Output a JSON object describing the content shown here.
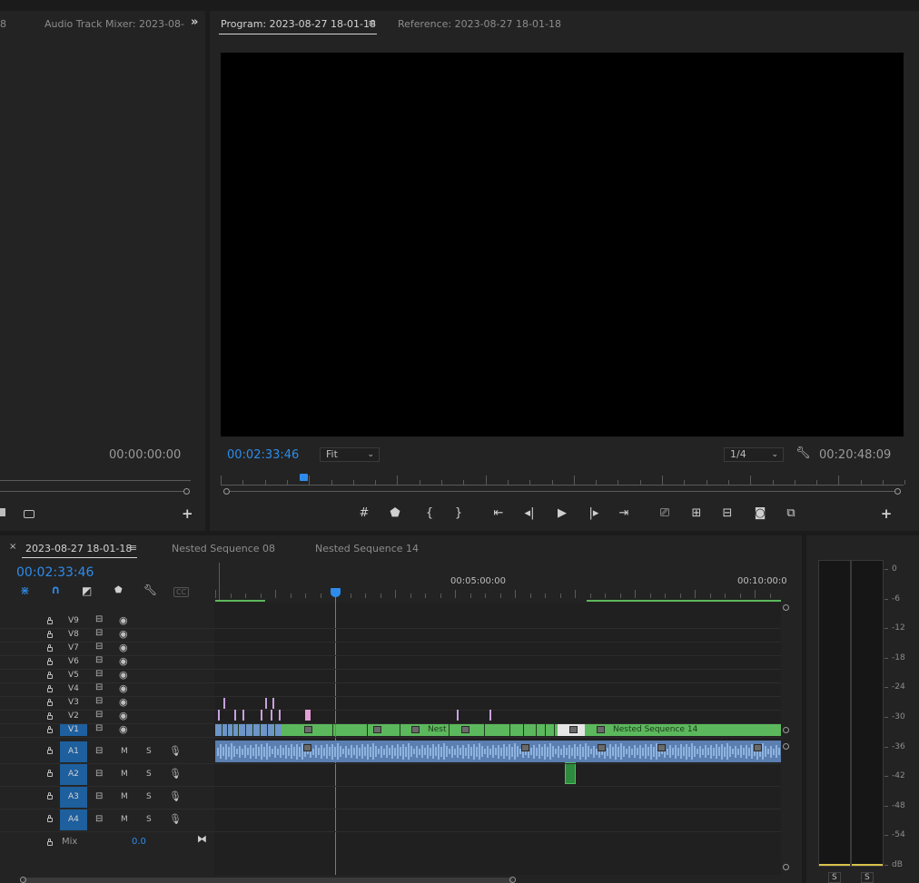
{
  "source_panel": {
    "tab_partial": "8",
    "tab_audio_mixer": "Audio Track Mixer: 2023-08-",
    "overflow_icon": "double-chevron-right-icon",
    "timecode": "00:00:00:00"
  },
  "program_panel": {
    "tab_program": "Program: 2023-08-27 18-01-18",
    "tab_reference": "Reference: 2023-08-27 18-01-18",
    "timecode_current": "00:02:33:46",
    "zoom": "Fit",
    "resolution": "1/4",
    "timecode_duration": "00:20:48:09"
  },
  "timeline": {
    "tabs": [
      {
        "label": "2023-08-27 18-01-18",
        "active": true
      },
      {
        "label": "Nested Sequence 08",
        "active": false
      },
      {
        "label": "Nested Sequence 14",
        "active": false
      }
    ],
    "timecode": "00:02:33:46",
    "ruler_labels": [
      "00:05:00:00",
      "00:10:00:0"
    ],
    "cc_label": "CC",
    "video_tracks": [
      "V9",
      "V8",
      "V7",
      "V6",
      "V5",
      "V4",
      "V3",
      "V2",
      "V1"
    ],
    "audio_tracks": [
      "A1",
      "A2",
      "A3",
      "A4"
    ],
    "audio_m": "M",
    "audio_s": "S",
    "mix_label": "Mix",
    "mix_value": "0.0",
    "clip_labels": {
      "nest": "Nest",
      "nested14": "Nested Sequence 14"
    }
  },
  "meter": {
    "scale": [
      "0",
      "-6",
      "-12",
      "-18",
      "-24",
      "-30",
      "-36",
      "-42",
      "-48",
      "-54",
      "dB"
    ],
    "solo_left": "S",
    "solo_right": "S"
  },
  "colors": {
    "accent_blue": "#2d8ceb",
    "clip_green": "#5cb85c",
    "clip_audio": "#6e95c8",
    "target_blue": "#1e5f9e"
  }
}
